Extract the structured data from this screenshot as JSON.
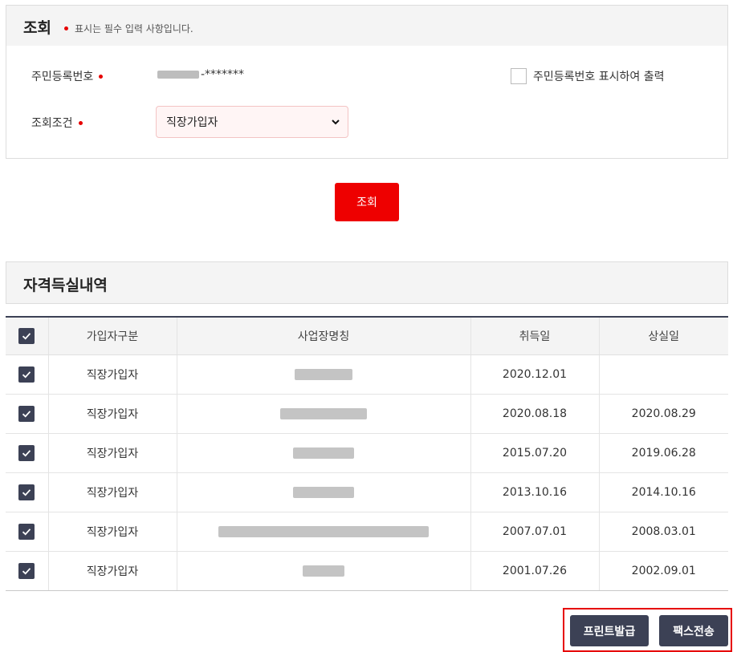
{
  "inquiry": {
    "title": "조회",
    "required_note": "표시는 필수 입력 사항입니다.",
    "rrn_label": "주민등록번호",
    "rrn_masked": "-*******",
    "show_rrn_checkbox_label": "주민등록번호 표시하여 출력",
    "condition_label": "조회조건",
    "condition_selected": "직장가입자",
    "search_button": "조회"
  },
  "history": {
    "title": "자격득실내역",
    "columns": [
      "가입자구분",
      "사업장명칭",
      "취득일",
      "상실일"
    ],
    "rows": [
      {
        "type": "직장가입자",
        "acquired": "2020.12.01",
        "lost": ""
      },
      {
        "type": "직장가입자",
        "acquired": "2020.08.18",
        "lost": "2020.08.29"
      },
      {
        "type": "직장가입자",
        "acquired": "2015.07.20",
        "lost": "2019.06.28"
      },
      {
        "type": "직장가입자",
        "acquired": "2013.10.16",
        "lost": "2014.10.16"
      },
      {
        "type": "직장가입자",
        "acquired": "2007.07.01",
        "lost": "2008.03.01"
      },
      {
        "type": "직장가입자",
        "acquired": "2001.07.26",
        "lost": "2002.09.01"
      }
    ]
  },
  "actions": {
    "print_button": "프린트발급",
    "fax_button": "팩스전송"
  },
  "colors": {
    "accent_red": "#ee0000",
    "dark_navy": "#3c4155"
  }
}
